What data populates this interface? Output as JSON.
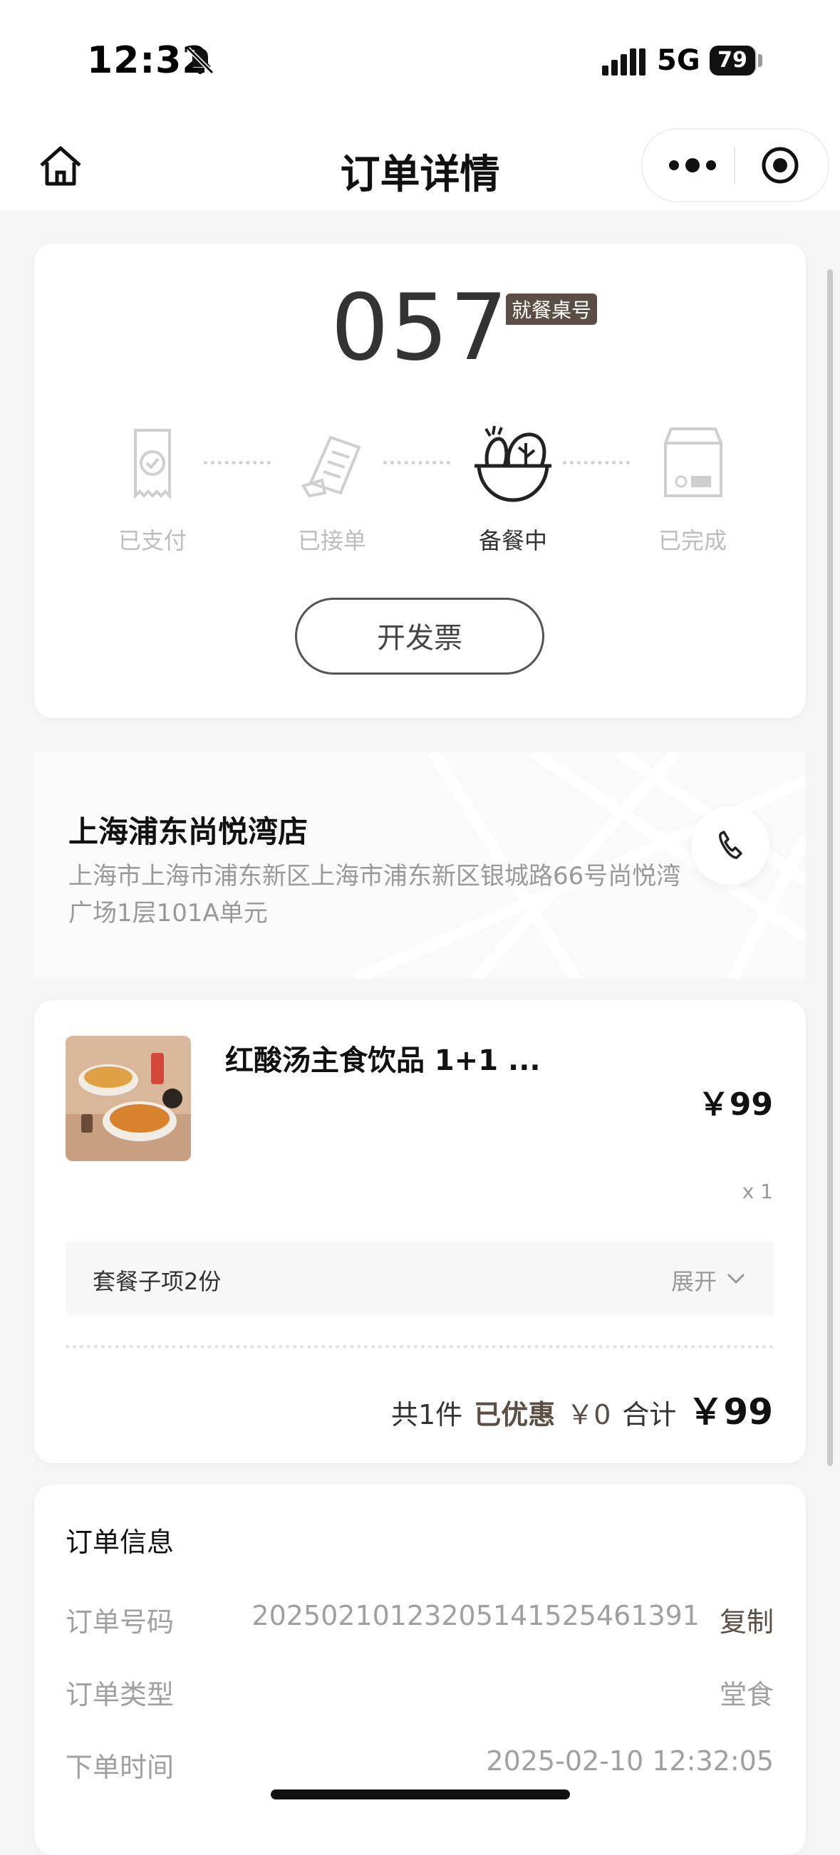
{
  "status": {
    "time": "12:32",
    "network": "5G",
    "battery": "79"
  },
  "nav": {
    "title": "订单详情"
  },
  "order_status": {
    "number": "057",
    "badge": "就餐桌号",
    "steps": [
      {
        "label": "已支付",
        "active": false
      },
      {
        "label": "已接单",
        "active": false
      },
      {
        "label": "备餐中",
        "active": true
      },
      {
        "label": "已完成",
        "active": false
      }
    ],
    "invoice_label": "开发票"
  },
  "store": {
    "name": "上海浦东尚悦湾店",
    "address": "上海市上海市浦东新区上海市浦东新区银城路66号尚悦湾广场1层101A单元"
  },
  "item": {
    "name": "红酸汤主食饮品 1+1 ...",
    "price": "￥99",
    "qty": "x 1",
    "sub_label": "套餐子项2份",
    "expand_label": "展开"
  },
  "totals": {
    "count": "共1件",
    "discount_label": "已优惠",
    "discount_value": "￥0",
    "sum_label": "合计",
    "sum_value": "￥99"
  },
  "order_info": {
    "title": "订单信息",
    "rows": [
      {
        "key": "订单号码",
        "value": "2025021012320514152546​1391",
        "action": "复制"
      },
      {
        "key": "订单类型",
        "value": "堂食"
      },
      {
        "key": "下单时间",
        "value": "2025-02-10 12:32:05"
      }
    ]
  },
  "colors": {
    "accent": "#5b4e44",
    "muted": "#bdbdbd"
  }
}
